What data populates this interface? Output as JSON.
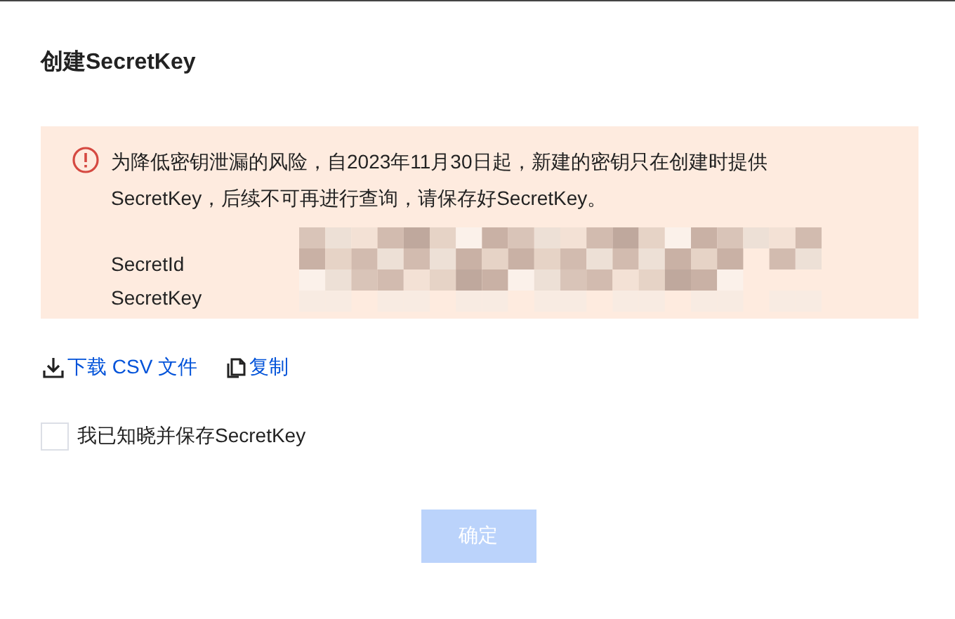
{
  "dialog": {
    "title": "创建SecretKey"
  },
  "notice": {
    "text": "为降低密钥泄漏的风险，自2023年11月30日起，新建的密钥只在创建时提供SecretKey，后续不可再进行查询，请保存好SecretKey。",
    "fields": [
      {
        "label": "SecretId"
      },
      {
        "label": "SecretKey"
      }
    ]
  },
  "links": [
    {
      "kind": "download",
      "label": "下载 CSV 文件"
    },
    {
      "kind": "copy",
      "label": "复制"
    }
  ],
  "acknowledge": {
    "label": "我已知晓并保存SecretKey",
    "checked": false
  },
  "confirm_button": {
    "label": "确定",
    "disabled": true
  }
}
